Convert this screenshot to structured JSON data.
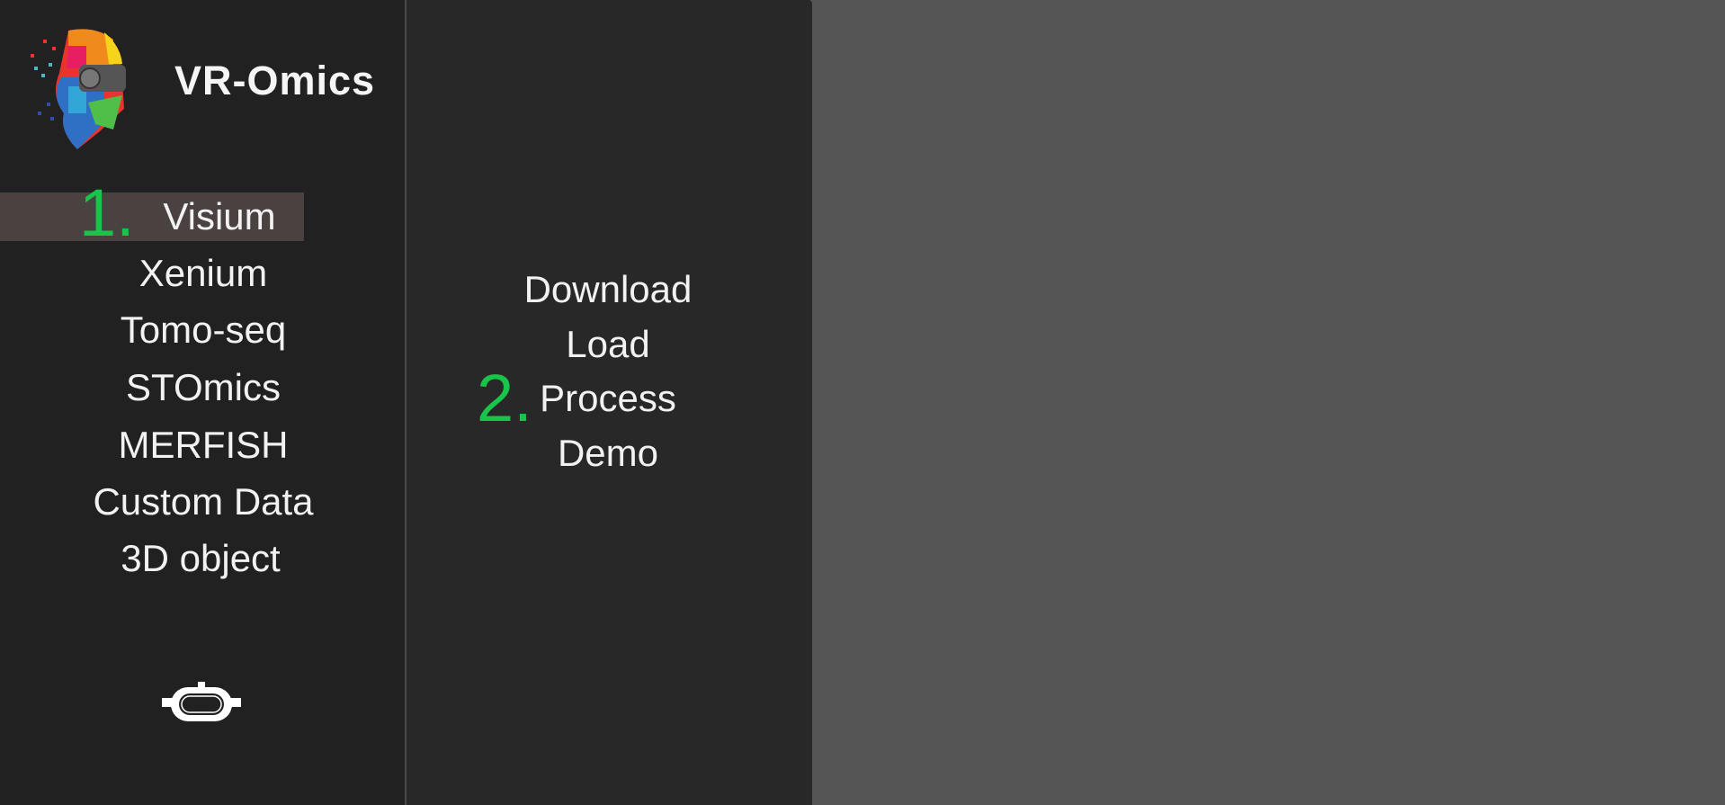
{
  "app": {
    "title": "VR-Omics",
    "logo_icon": "vr-head-logo-icon"
  },
  "sidebar": {
    "step_label": "1.",
    "selected": "Visium",
    "items": [
      {
        "label": "Visium"
      },
      {
        "label": "Xenium"
      },
      {
        "label": "Tomo-seq"
      },
      {
        "label": "STOmics"
      },
      {
        "label": "MERFISH"
      },
      {
        "label": "Custom Data"
      },
      {
        "label": "3D object"
      }
    ],
    "vr_button_icon": "vr-headset-icon"
  },
  "submenu": {
    "step_label": "2.",
    "items": [
      {
        "label": "Download"
      },
      {
        "label": "Load"
      },
      {
        "label": "Process"
      },
      {
        "label": "Demo"
      }
    ]
  },
  "colors": {
    "accent_green": "#19c44a",
    "selected_bg": "#4a4241",
    "sidebar_bg": "#212121",
    "submenu_bg": "#282828",
    "content_bg": "#555555"
  }
}
